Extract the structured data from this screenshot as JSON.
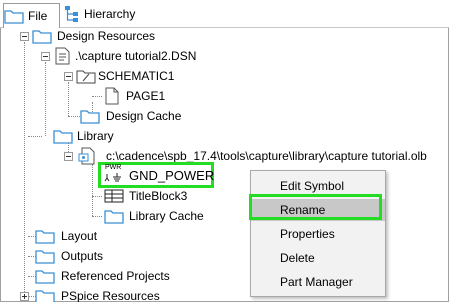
{
  "tabs": {
    "file_label": "File",
    "hierarchy_label": "Hierarchy"
  },
  "tree": {
    "design_resources": "Design Resources",
    "dsn_file": ".\\capture tutorial2.DSN",
    "schematic": "SCHEMATIC1",
    "page": "PAGE1",
    "design_cache": "Design Cache",
    "library": "Library",
    "olb_path": "c:\\cadence\\spb_17.4\\tools\\capture\\library\\capture tutorial.olb",
    "gnd_power": "GND_POWER",
    "titleblock": "TitleBlock3",
    "library_cache": "Library Cache",
    "layout": "Layout",
    "outputs": "Outputs",
    "referenced_projects": "Referenced Projects",
    "pspice_resources": "PSpice Resources"
  },
  "pwr_icon_text": "PWR",
  "context_menu": {
    "items": [
      "Edit Symbol",
      "Rename",
      "Properties",
      "Delete",
      "Part Manager"
    ],
    "selected": "Rename"
  },
  "colors": {
    "highlight": "#22dd22",
    "folder": "#3a8fd6",
    "menu_bg": "#f2f2f2",
    "selected_bg": "#c8c8c8"
  }
}
